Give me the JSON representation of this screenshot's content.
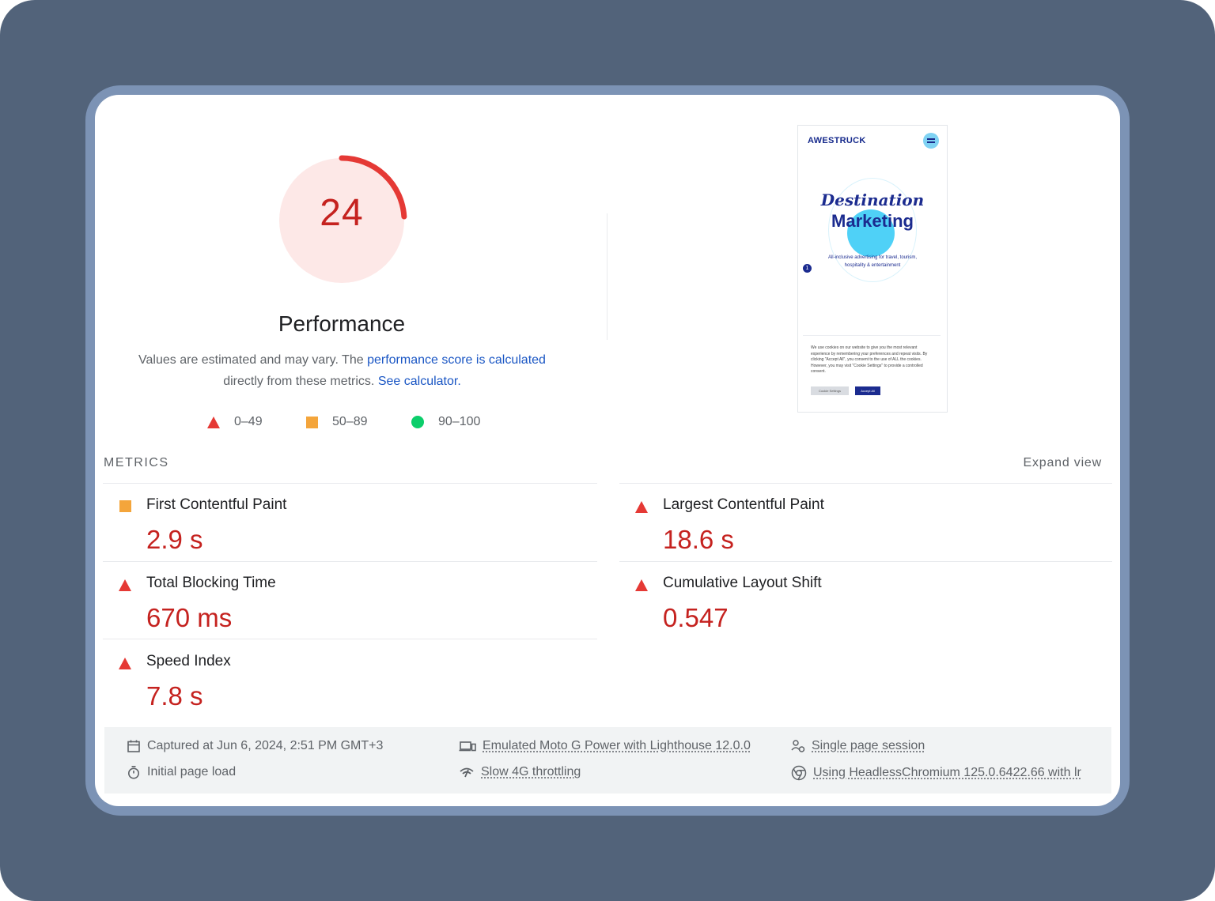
{
  "score": {
    "value": "24",
    "fraction": 0.24,
    "color": "#c5221f",
    "track_color": "#fde8e7",
    "arc_color": "#e53935"
  },
  "category_title": "Performance",
  "description": {
    "text1": "Values are estimated and may vary. The ",
    "link1": "performance score is calculated",
    "text2": " directly from these metrics. ",
    "link2": "See calculator."
  },
  "legend": [
    {
      "range": "0–49",
      "shape": "triangle",
      "color": "#e53935"
    },
    {
      "range": "50–89",
      "shape": "square",
      "color": "#f4a53b"
    },
    {
      "range": "90–100",
      "shape": "circle",
      "color": "#0cce6b"
    }
  ],
  "thumbnail": {
    "logo": "AWESTRUCK",
    "title_line1": "Destination",
    "title_line2": "Marketing",
    "subtitle": "All-inclusive advertising for travel, tourism, hospitality & entertainment",
    "badge": "1",
    "cookie_text": "We use cookies on our website to give you the most relevant experience by remembering your preferences and repeat visits. By clicking \"Accept All\", you consent to the use of ALL the cookies. However, you may visit \"Cookie Settings\" to provide a controlled consent.",
    "btn_settings": "Cookie Settings",
    "btn_accept": "Accept All"
  },
  "metrics_header": "METRICS",
  "expand_view": "Expand view",
  "metrics": [
    {
      "label": "First Contentful Paint",
      "value": "2.9 s",
      "rating": "average"
    },
    {
      "label": "Largest Contentful Paint",
      "value": "18.6 s",
      "rating": "fail"
    },
    {
      "label": "Total Blocking Time",
      "value": "670 ms",
      "rating": "fail"
    },
    {
      "label": "Cumulative Layout Shift",
      "value": "0.547",
      "rating": "fail"
    },
    {
      "label": "Speed Index",
      "value": "7.8 s",
      "rating": "fail"
    }
  ],
  "footer": {
    "captured": "Captured at Jun 6, 2024, 2:51 PM GMT+3",
    "load_type": "Initial page load",
    "device": "Emulated Moto G Power with Lighthouse 12.0.0",
    "throttling": "Slow 4G throttling",
    "session": "Single page session",
    "browser": "Using HeadlessChromium 125.0.6422.66 with lr"
  }
}
